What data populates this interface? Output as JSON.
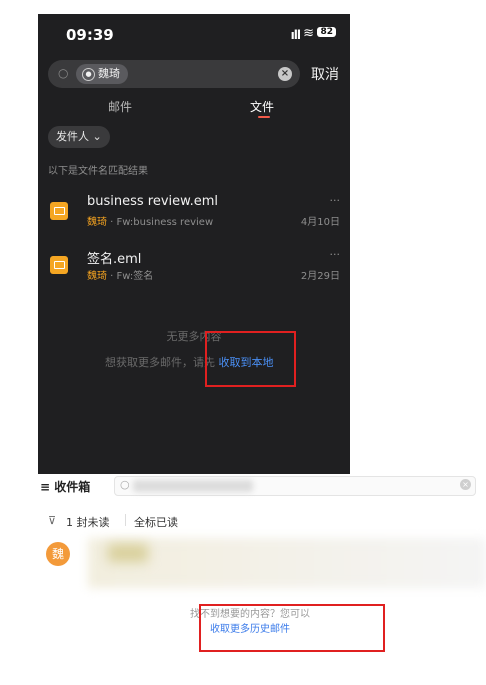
{
  "status_bar": {
    "time": "09:39",
    "signal": "ıll",
    "wifi": "wifi-icon",
    "battery": "82"
  },
  "search": {
    "chip": "魏琦",
    "cancel": "取消"
  },
  "tabs": [
    {
      "label": "邮件",
      "active": false
    },
    {
      "label": "文件",
      "active": true
    }
  ],
  "filter": {
    "sender": "发件人 ⌄"
  },
  "results_hint": "以下是文件名匹配结果",
  "files": [
    {
      "name": "business review.eml",
      "who": "魏琦",
      "sub": " · Fw:business review",
      "date": "4月10日",
      "more": "···"
    },
    {
      "name": "签名.eml",
      "who": "魏琦",
      "sub": " · Fw:签名",
      "date": "2月29日",
      "more": "···"
    }
  ],
  "empty": {
    "no_more": "无更多内容",
    "fetch_prefix": "想获取更多邮件，请先 ",
    "fetch_link": "收取到本地"
  },
  "inbox": {
    "title": "≡ 收件箱",
    "unread": "1 封未读",
    "mark_all": "全标已读",
    "avatar": "魏",
    "not_found": "找不到想要的内容？您可以",
    "history_link": "收取更多历史邮件"
  },
  "colors": {
    "accent": "#f15a4a",
    "link": "#4a8ff5",
    "highlight": "#e02020"
  }
}
